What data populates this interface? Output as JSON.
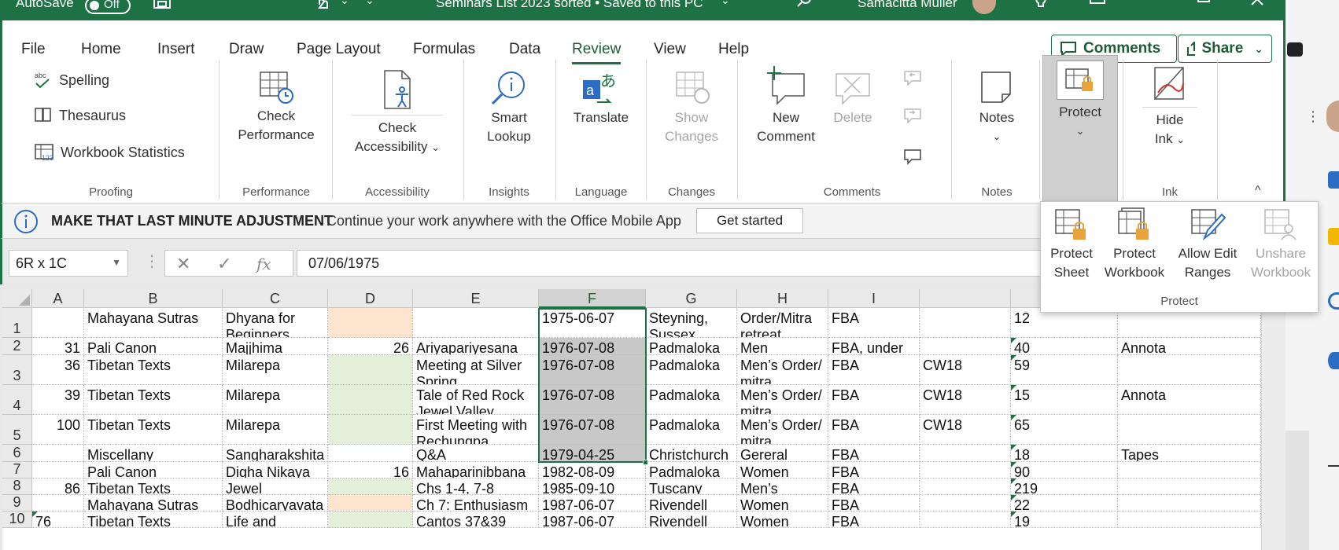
{
  "titlebar": {
    "autosave_label": "AutoSave",
    "autosave_state": "Off",
    "doc_title": "Seminars List 2023 sorted • Saved to this PC",
    "user_name": "Samacitta Muller"
  },
  "menu": {
    "tabs": [
      "File",
      "Home",
      "Insert",
      "Draw",
      "Page Layout",
      "Formulas",
      "Data",
      "Review",
      "View",
      "Help"
    ],
    "active": "Review",
    "comments_label": "Comments",
    "share_label": "Share"
  },
  "ribbon": {
    "proofing": {
      "spelling": "Spelling",
      "thesaurus": "Thesaurus",
      "workbook_statistics": "Workbook Statistics",
      "label": "Proofing"
    },
    "performance": {
      "check_l1": "Check",
      "check_l2": "Performance",
      "label": "Performance"
    },
    "accessibility": {
      "check_l1": "Check",
      "check_l2": "Accessibility",
      "label": "Accessibility"
    },
    "insights": {
      "smart_l1": "Smart",
      "smart_l2": "Lookup",
      "label": "Insights"
    },
    "language": {
      "translate": "Translate",
      "label": "Language"
    },
    "changes": {
      "show_l1": "Show",
      "show_l2": "Changes",
      "label": "Changes"
    },
    "comments": {
      "new_l1": "New",
      "new_l2": "Comment",
      "delete": "Delete",
      "label": "Comments"
    },
    "notes": {
      "notes": "Notes",
      "label": "Notes"
    },
    "protect": {
      "protect": "Protect"
    },
    "ink": {
      "hide_l1": "Hide",
      "hide_l2": "Ink",
      "label": "Ink"
    }
  },
  "notification": {
    "headline": "MAKE THAT LAST MINUTE ADJUSTMENT",
    "message": "Continue your work anywhere with the Office Mobile App",
    "button": "Get started"
  },
  "formula_bar": {
    "name_box": "6R x 1C",
    "formula": "07/06/1975"
  },
  "protect_menu": {
    "items": [
      {
        "l1": "Protect",
        "l2": "Sheet"
      },
      {
        "l1": "Protect",
        "l2": "Workbook"
      },
      {
        "l1": "Allow Edit",
        "l2": "Ranges"
      },
      {
        "l1": "Unshare",
        "l2": "Workbook"
      }
    ],
    "label": "Protect"
  },
  "grid": {
    "columns": [
      "A",
      "B",
      "C",
      "D",
      "E",
      "F",
      "G",
      "H",
      "I"
    ],
    "rows": [
      {
        "n": "1",
        "A": "",
        "B": "Mahayana Sutras",
        "C": "Dhyana for Beginners",
        "D": "",
        "E": "",
        "F": "1975-06-07",
        "G": "Steyning, Sussex",
        "H": "Order/Mitra retreat",
        "I": "FBA",
        "J": "",
        "K": "12",
        "L": ""
      },
      {
        "n": "2",
        "A": "31",
        "B": "Pali Canon",
        "C": "Majjhima",
        "D": "26",
        "E": "Ariyapariyesana",
        "F": "1976-07-08",
        "G": "Padmaloka",
        "H": "Men",
        "I": "FBA, under",
        "J": "",
        "K": "40",
        "L": "Annota"
      },
      {
        "n": "3",
        "A": "36",
        "B": "Tibetan Texts",
        "C": "Milarepa",
        "D": "",
        "E": "Meeting at Silver Spring",
        "F": "1976-07-08",
        "G": "Padmaloka",
        "H": "Men’s Order/ mitra",
        "I": "FBA",
        "J": "CW18",
        "K": "59",
        "L": ""
      },
      {
        "n": "4",
        "A": "39",
        "B": "Tibetan Texts",
        "C": "Milarepa",
        "D": "",
        "E": "Tale of Red Rock Jewel Valley",
        "F": "1976-07-08",
        "G": "Padmaloka",
        "H": "Men’s Order/ mitra",
        "I": "FBA",
        "J": "CW18",
        "K": "15",
        "L": "Annota"
      },
      {
        "n": "5",
        "A": "100",
        "B": "Tibetan Texts",
        "C": "Milarepa",
        "D": "",
        "E": "First Meeting with Rechungpa",
        "F": "1976-07-08",
        "G": "Padmaloka",
        "H": "Men’s Order/ mitra",
        "I": "FBA",
        "J": "CW18",
        "K": "65",
        "L": ""
      },
      {
        "n": "6",
        "A": "",
        "B": "Miscellany",
        "C": "Sangharakshita",
        "D": "",
        "E": "Q&A",
        "F": "1979-04-25",
        "G": "Christchurch",
        "H": "Gereral",
        "I": "FBA",
        "J": "",
        "K": "18",
        "L": "Tapes"
      },
      {
        "n": "7",
        "A": "",
        "B": "Pali Canon",
        "C": "Digha Nikaya",
        "D": "16",
        "E": "Mahaparinibbana",
        "F": "1982-08-09",
        "G": "Padmaloka",
        "H": "Women",
        "I": "FBA",
        "J": "",
        "K": "90",
        "L": ""
      },
      {
        "n": "8",
        "A": "86",
        "B": "Tibetan Texts",
        "C": "Jewel",
        "D": "",
        "E": "Chs 1-4, 7-8",
        "F": "1985-09-10",
        "G": "Tuscany",
        "H": "Men’s",
        "I": "FBA",
        "J": "",
        "K": "219",
        "L": ""
      },
      {
        "n": "9",
        "A": "",
        "B": "Mahayana Sutras",
        "C": "Bodhicaryavata",
        "D": "",
        "E": "Ch 7: Enthusiasm",
        "F": "1987-06-07",
        "G": "Rivendell",
        "H": "Women",
        "I": "FBA",
        "J": "",
        "K": "22",
        "L": ""
      },
      {
        "n": "10",
        "A": "76",
        "B": "Tibetan Texts",
        "C": "Life and",
        "D": "",
        "E": "Cantos 37&39",
        "F": "1987-06-07",
        "G": "Rivendell",
        "H": "Women",
        "I": "FBA",
        "J": "",
        "K": "19",
        "L": ""
      }
    ]
  },
  "colors": {
    "excel_green": "#1e7145",
    "peach_fill": "#fde4cf",
    "light_green_fill": "#e3efd9",
    "selection_gray": "#c8c8c8"
  }
}
